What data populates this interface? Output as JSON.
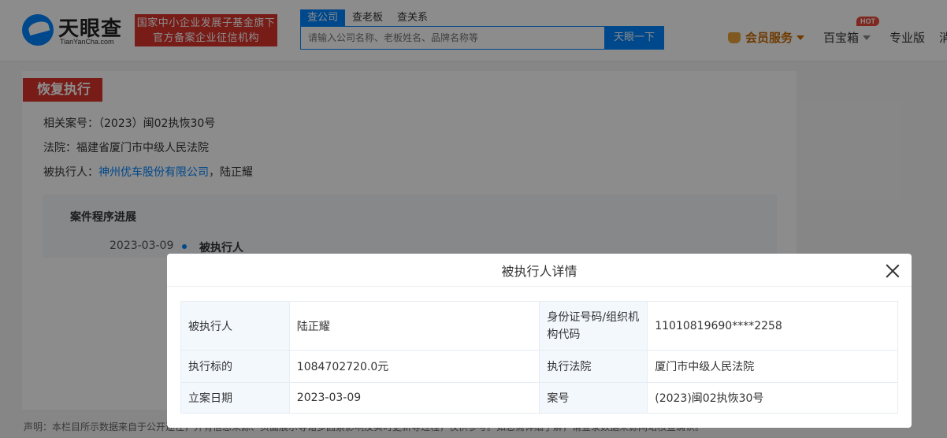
{
  "header": {
    "logo_text": "天眼查",
    "logo_sub": "TianYanCha.com",
    "badge_line1": "国家中小企业发展子基金旗下",
    "badge_line2": "官方备案企业征信机构",
    "search_tabs": [
      "查公司",
      "查老板",
      "查关系"
    ],
    "search_placeholder": "请输入公司名称、老板姓名、品牌名称等",
    "search_button": "天眼一下",
    "nav_vip": "会员服务",
    "nav_bao": "百宝箱",
    "hot": "HOT",
    "nav_pro": "专业版",
    "nav_more": "消"
  },
  "section": {
    "tag": "恢复执行",
    "case_label": "相关案号：",
    "case_value": "（2023）闽02执恢30号",
    "court_label": "法院：",
    "court_value": "福建省厦门市中级人民法院",
    "executed_label": "被执行人：",
    "executed_company": "神州优车股份有限公司",
    "executed_sep": "，",
    "executed_person": "陆正耀",
    "progress_title": "案件程序进展",
    "progress_date": "2023-03-09",
    "progress_label": "被执行人"
  },
  "disclaimer": "声明：本栏目所示数据来自于公开途径，并有信息来源、页面展示等诸多因素影响及实时更新等过程，仅供参考。如您需详细了解，请登录数据来源网站核查确认。",
  "modal": {
    "title": "被执行人详情",
    "rows": [
      {
        "label1": "被执行人",
        "value1": "陆正耀",
        "label2": "身份证号码/组织机构代码",
        "value2": "11010819690****2258"
      },
      {
        "label1": "执行标的",
        "value1": "1084702720.0元",
        "label2": "执行法院",
        "value2": "厦门市中级人民法院"
      },
      {
        "label1": "立案日期",
        "value1": "2023-03-09",
        "label2": "案号",
        "value2": "(2023)闽02执恢30号"
      }
    ]
  }
}
